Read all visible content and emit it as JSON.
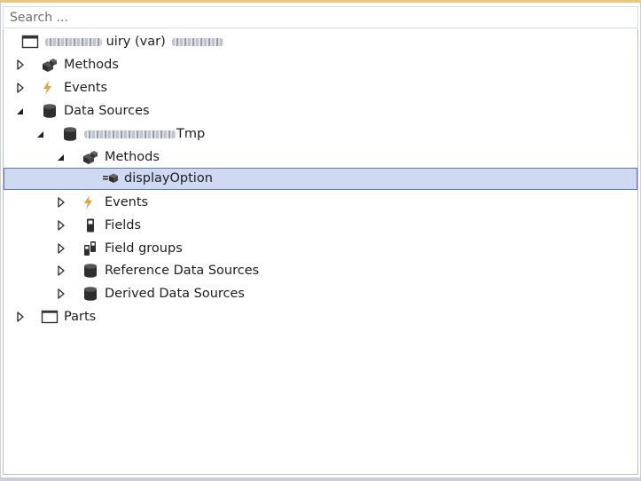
{
  "search": {
    "placeholder": "Search ..."
  },
  "tree": {
    "root": {
      "label": "uiry (var)"
    },
    "items": [
      {
        "label": "Methods"
      },
      {
        "label": "Events"
      },
      {
        "label": "Data Sources"
      },
      {
        "label": "Tmp"
      },
      {
        "label": "Methods"
      },
      {
        "label": "displayOption"
      },
      {
        "label": "Events"
      },
      {
        "label": "Fields"
      },
      {
        "label": "Field groups"
      },
      {
        "label": "Reference Data Sources"
      },
      {
        "label": "Derived Data Sources"
      },
      {
        "label": "Parts"
      }
    ]
  },
  "colors": {
    "selection_fill": "#cfd9f1",
    "selection_border": "#6677b8",
    "events_icon": "#e8a23b",
    "icon_dark": "#3a3a3a"
  }
}
